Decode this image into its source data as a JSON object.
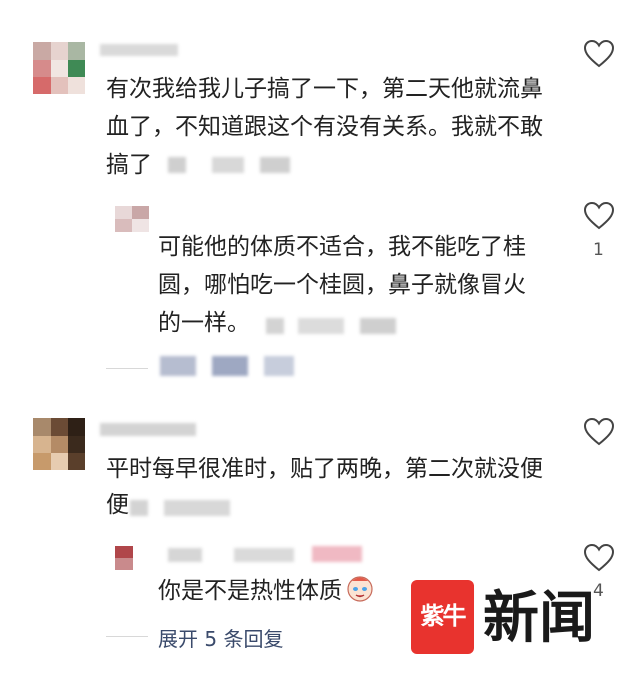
{
  "comments": [
    {
      "text_lines": [
        "有次我给我儿子搞了一下，第二天他就流鼻",
        "血了，不知道跟这个有没有关系。我就不敢",
        "搞了"
      ],
      "like_count": ""
    },
    {
      "text_lines": [
        "可能他的体质不适合，我不能吃了桂",
        "圆，哪怕吃一个桂圆，鼻子就像冒火",
        "的一样。"
      ],
      "like_count": "1"
    },
    {
      "text_lines": [
        "平时每早很准时，贴了两晚，第二次就没便",
        "便"
      ],
      "like_count": ""
    },
    {
      "text_lines": [
        "你是不是热性体质"
      ],
      "like_count": "4"
    }
  ],
  "expand_replies": "展开 5 条回复",
  "watermark": {
    "logo_text": "紫牛",
    "brand_text": "新闻"
  },
  "colors": {
    "accent": "#3a4a6b",
    "brand_red": "#e8332e"
  }
}
